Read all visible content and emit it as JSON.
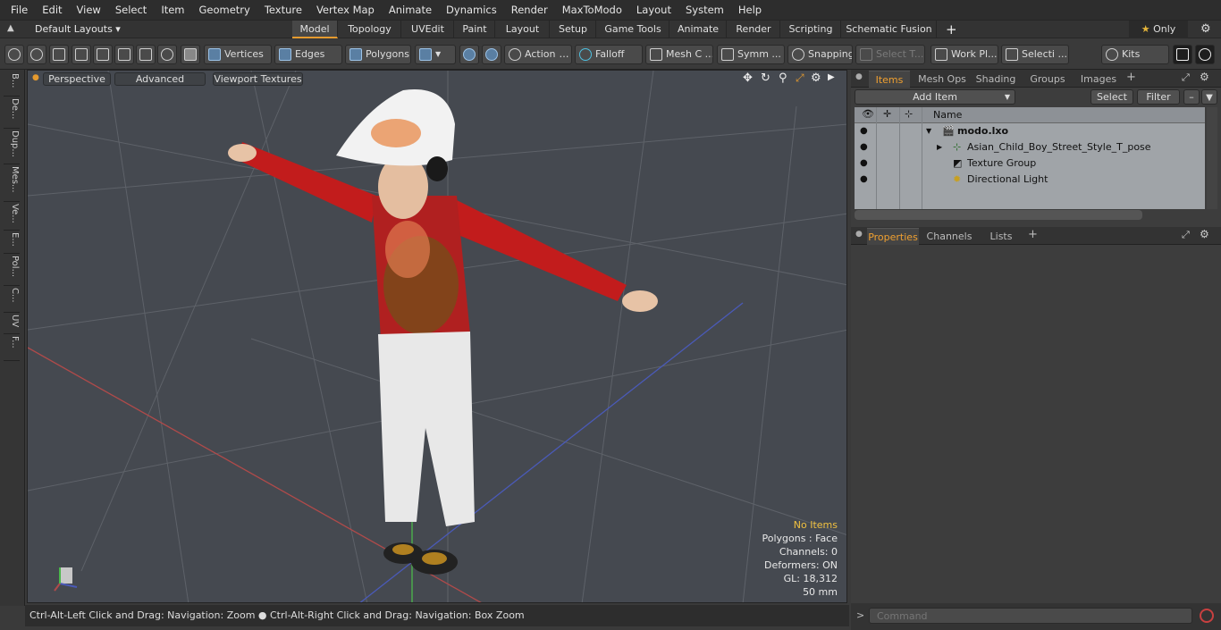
{
  "menu": [
    "File",
    "Edit",
    "View",
    "Select",
    "Item",
    "Geometry",
    "Texture",
    "Vertex Map",
    "Animate",
    "Dynamics",
    "Render",
    "MaxToModo",
    "Layout",
    "System",
    "Help"
  ],
  "layout_selector": "Default Layouts ▾",
  "layout_tabs": [
    {
      "label": "Model",
      "active": true
    },
    {
      "label": "Topology"
    },
    {
      "label": "UVEdit"
    },
    {
      "label": "Paint"
    },
    {
      "label": "Layout"
    },
    {
      "label": "Setup"
    },
    {
      "label": "Game Tools"
    },
    {
      "label": "Animate"
    },
    {
      "label": "Render"
    },
    {
      "label": "Scripting"
    },
    {
      "label": "Schematic Fusion"
    }
  ],
  "only_label": "Only",
  "toolbar": {
    "vertices": "Vertices",
    "edges": "Edges",
    "polygons": "Polygons",
    "action": "Action",
    "falloff": "Falloff",
    "mesh": "Mesh C ...",
    "symm": "Symm ...",
    "snapping": "Snapping",
    "select_t": "Select T...",
    "work_pl": "Work Pl...",
    "selecti": "Selecti ...",
    "kits": "Kits"
  },
  "left_tabs": [
    "B...",
    "De...",
    "Dup...",
    "Mes...",
    "Ve...",
    "E...",
    "Pol...",
    "C...",
    "UV",
    "F..."
  ],
  "viewport": {
    "perspective": "Perspective",
    "advanced": "Advanced",
    "textures": "Viewport Textures",
    "info": {
      "no_items": "No Items",
      "polygons": "Polygons : Face",
      "channels": "Channels: 0",
      "deformers": "Deformers: ON",
      "gl": "GL: 18,312",
      "mm": "50 mm"
    }
  },
  "status": "Ctrl-Alt-Left Click and Drag: Navigation: Zoom ● Ctrl-Alt-Right Click and Drag: Navigation: Box Zoom",
  "items_panel": {
    "tabs": [
      "Items",
      "Mesh Ops",
      "Shading",
      "Groups",
      "Images"
    ],
    "add_item": "Add Item",
    "select": "Select",
    "filter": "Filter",
    "col_name": "Name",
    "scene": "modo.lxo",
    "rows": [
      "Asian_Child_Boy_Street_Style_T_pose",
      "Texture Group",
      "Directional Light"
    ]
  },
  "properties_panel": {
    "tabs": [
      "Properties",
      "Channels",
      "Lists"
    ]
  },
  "command_placeholder": "Command",
  "colors": {
    "accent": "#e59a2e",
    "viewport_bg": "#4a4d52",
    "list_bg": "#a0a4a8"
  }
}
